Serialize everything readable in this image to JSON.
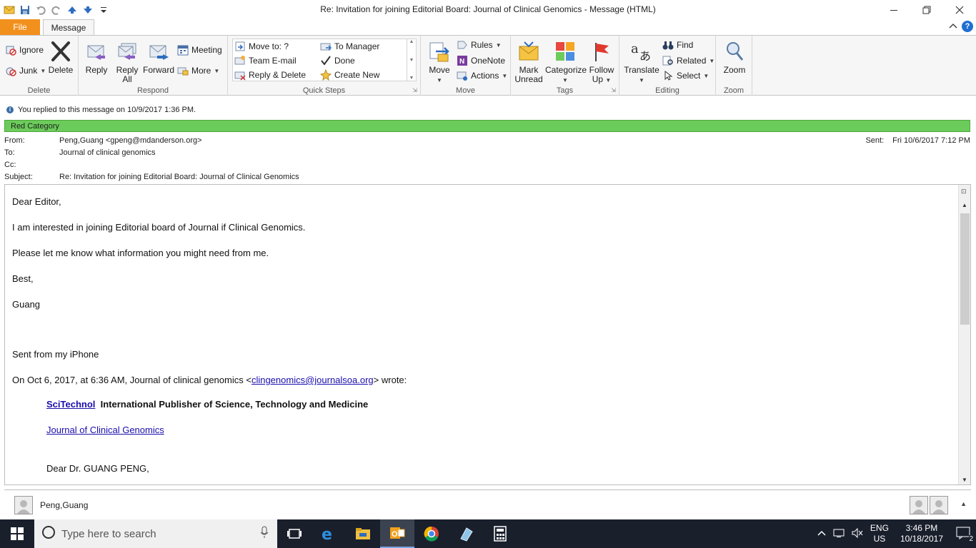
{
  "window": {
    "title": "Re: Invitation for joining Editorial Board: Journal of Clinical Genomics  -  Message (HTML)"
  },
  "tabs": {
    "file": "File",
    "message": "Message"
  },
  "ribbon": {
    "delete_group": {
      "label": "Delete",
      "ignore": "Ignore",
      "junk": "Junk",
      "delete": "Delete"
    },
    "respond_group": {
      "label": "Respond",
      "reply": "Reply",
      "reply_all_line1": "Reply",
      "reply_all_line2": "All",
      "forward": "Forward",
      "meeting": "Meeting",
      "more": "More"
    },
    "quicksteps_group": {
      "label": "Quick Steps",
      "move_to": "Move to: ?",
      "team_email": "Team E-mail",
      "reply_delete": "Reply & Delete",
      "to_manager": "To Manager",
      "done": "Done",
      "create_new": "Create New"
    },
    "move_group": {
      "label": "Move",
      "move": "Move",
      "rules": "Rules",
      "onenote": "OneNote",
      "actions": "Actions"
    },
    "tags_group": {
      "label": "Tags",
      "mark_unread_line1": "Mark",
      "mark_unread_line2": "Unread",
      "categorize": "Categorize",
      "follow_up_line1": "Follow",
      "follow_up_line2": "Up"
    },
    "editing_group": {
      "label": "Editing",
      "translate": "Translate",
      "find": "Find",
      "related": "Related",
      "select": "Select"
    },
    "zoom_group": {
      "label": "Zoom",
      "zoom": "Zoom"
    }
  },
  "infobar": {
    "text": "You replied to this message on 10/9/2017 1:36 PM."
  },
  "category": {
    "text": "Red Category",
    "color": "#6ccc5b"
  },
  "header": {
    "from_label": "From:",
    "from_value": "Peng,Guang <gpeng@mdanderson.org>",
    "to_label": "To:",
    "to_value": "Journal of clinical genomics",
    "cc_label": "Cc:",
    "cc_value": "",
    "subject_label": "Subject:",
    "subject_value": "Re: Invitation for joining Editorial Board: Journal of Clinical Genomics",
    "sent_label": "Sent:",
    "sent_value": "Fri 10/6/2017 7:12 PM"
  },
  "body": {
    "greeting": "Dear Editor,",
    "line1": "I am interested in joining Editorial board of Journal if Clinical Genomics.",
    "line2": "Please let me know what information you might need from me.",
    "closing": "Best,",
    "signature": "Guang",
    "sent_from": "Sent from my iPhone",
    "quote_prefix": "On Oct 6, 2017, at 6:36 AM, Journal of clinical genomics <",
    "quote_email": "clingenomics@journalsoa.org",
    "quote_suffix": "> wrote:",
    "scitechnol_link": "SciTechnol",
    "publisher_tagline": "International Publisher of Science, Technology and Medicine",
    "journal_link": "Journal of Clinical Genomics",
    "quoted_greeting": "Dear Dr. GUANG PENG,"
  },
  "people_pane": {
    "name": "Peng,Guang"
  },
  "taskbar": {
    "search_placeholder": "Type here to search",
    "lang_line1": "ENG",
    "lang_line2": "US",
    "time": "3:46 PM",
    "date": "10/18/2017",
    "notifications": "2"
  }
}
